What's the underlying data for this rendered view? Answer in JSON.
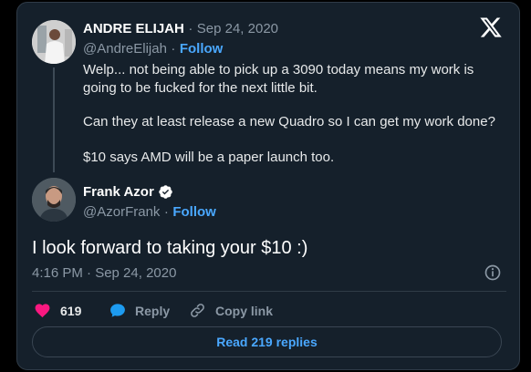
{
  "brand": {
    "logo": "x-logo-icon"
  },
  "parent_tweet": {
    "author_name": "ANDRE ELIJAH",
    "separator": "·",
    "date": "Sep 24, 2020",
    "handle": "@AndreElijah",
    "follow_label": "Follow",
    "lines": [
      "Welp... not being able to pick up a 3090 today means my work is",
      "going to be fucked for the next little bit.",
      "Can they at least release a new Quadro so I can get my work done?",
      "$10 says AMD will be a paper launch too."
    ]
  },
  "reply_tweet": {
    "author_name": "Frank Azor",
    "verified_icon": "verified-badge-icon",
    "handle": "@AzorFrank",
    "separator": "·",
    "follow_label": "Follow",
    "text": "I look forward to taking your $10 :)",
    "timestamp": "4:16 PM · Sep 24, 2020",
    "info_icon": "info-icon"
  },
  "actions": {
    "like_count": "619",
    "reply_label": "Reply",
    "copy_link_label": "Copy link"
  },
  "read_replies_label": "Read 219 replies",
  "colors": {
    "background": "#15202b",
    "accent": "#4aa8ff",
    "like": "#f91880",
    "verified": "#ffffff"
  }
}
